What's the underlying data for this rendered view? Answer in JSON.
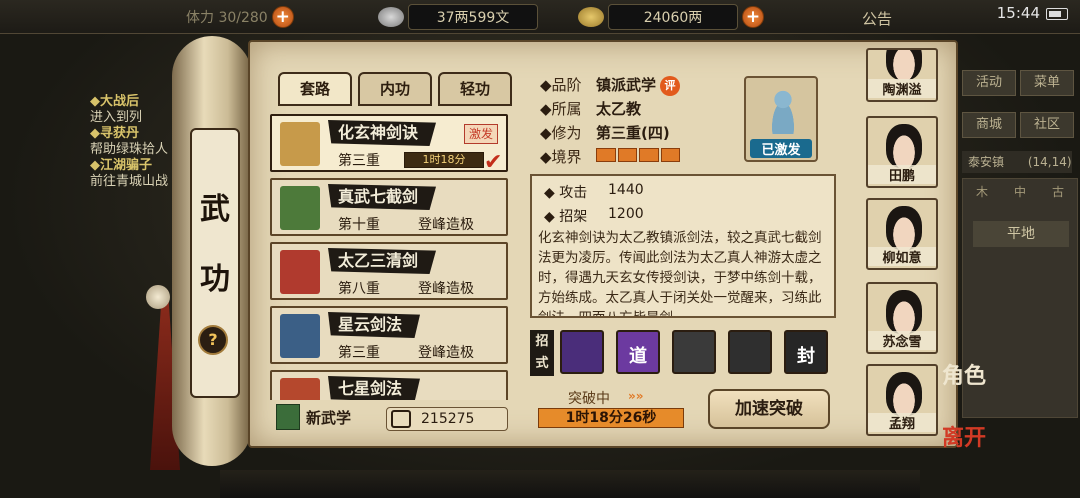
{
  "topbar": {
    "stamina": "体力 30/280",
    "silver": "37两599文",
    "gold": "24060两",
    "notice": "公告",
    "time": "15:44"
  },
  "quest": [
    {
      "title": "◆大战后",
      "text": "进入到列"
    },
    {
      "title": "◆寻获丹",
      "text": "帮助绿珠拾人"
    },
    {
      "title": "◆江湖骗子",
      "text": "前往青城山战"
    }
  ],
  "right": {
    "buttons": [
      "活动",
      "菜单",
      "商城",
      "社区"
    ],
    "location": "泰安镇",
    "coords": "(14,14)",
    "map_tabs": [
      "木",
      "中",
      "古"
    ],
    "terrain": "平地"
  },
  "scroll": {
    "char1": "武",
    "char2": "功",
    "help": "?"
  },
  "tabs": [
    "套路",
    "内功",
    "轻功"
  ],
  "skills": [
    {
      "name": "化玄神剑诀",
      "level": "第三重",
      "timer": "1时18分",
      "tag": "激发",
      "book_color": "#c79a4a"
    },
    {
      "name": "真武七截剑",
      "level": "第十重",
      "progress": "登峰造极",
      "book_color": "#4d7a3a"
    },
    {
      "name": "太乙三清剑",
      "level": "第八重",
      "progress": "登峰造极",
      "book_color": "#b03a2e"
    },
    {
      "name": "星云剑法",
      "level": "第三重",
      "progress": "登峰造极",
      "book_color": "#3b5f86"
    },
    {
      "name": "七星剑法",
      "level": "",
      "progress": "",
      "book_color": "#b5482d"
    }
  ],
  "footer_left": {
    "new": "新武学",
    "points": "215275"
  },
  "info": {
    "rank_k": "品阶",
    "rank_v": "镇派武学",
    "rank_badge": "评",
    "sect_k": "所属",
    "sect_v": "太乙教",
    "cult_k": "修为",
    "cult_v": "第三重(四)",
    "realm_k": "境界",
    "avatar_status": "已激发"
  },
  "stats": {
    "atk_k": "攻击",
    "atk_v": "1440",
    "par_k": "招架",
    "par_v": "1200"
  },
  "description": "化玄神剑诀为太乙教镇派剑法，较之真武七截剑法更为凌厉。传闻此剑法为太乙真人神游太虚之时，得遇九天玄女传授剑诀，于梦中练剑十载，方始练成。太乙真人于闭关处一觉醒来，习练此剑法，四面八方皆是剑",
  "moves": {
    "label": "招式",
    "items": [
      {
        "icon": "sword-purple-icon",
        "text": "",
        "color": "#4a2d7a"
      },
      {
        "icon": "dao-icon",
        "text": "道",
        "color": "#6c3aa0"
      },
      {
        "icon": "slash-icon",
        "text": "",
        "color": "#3a3a3a"
      },
      {
        "icon": "wind-slash-icon",
        "text": "",
        "color": "#2f2f2f"
      },
      {
        "icon": "seal-icon",
        "text": "封",
        "color": "#262626"
      }
    ]
  },
  "breakthrough": {
    "label": "突破中",
    "arrows": "»»",
    "timer": "1时18分26秒",
    "speed": "加速突破"
  },
  "party": [
    {
      "name": "陶渊溢"
    },
    {
      "name": "田鹏"
    },
    {
      "name": "柳如意"
    },
    {
      "name": "苏念雪"
    },
    {
      "name": "孟翔"
    }
  ],
  "side": {
    "role": "角色",
    "leave": "离开"
  }
}
